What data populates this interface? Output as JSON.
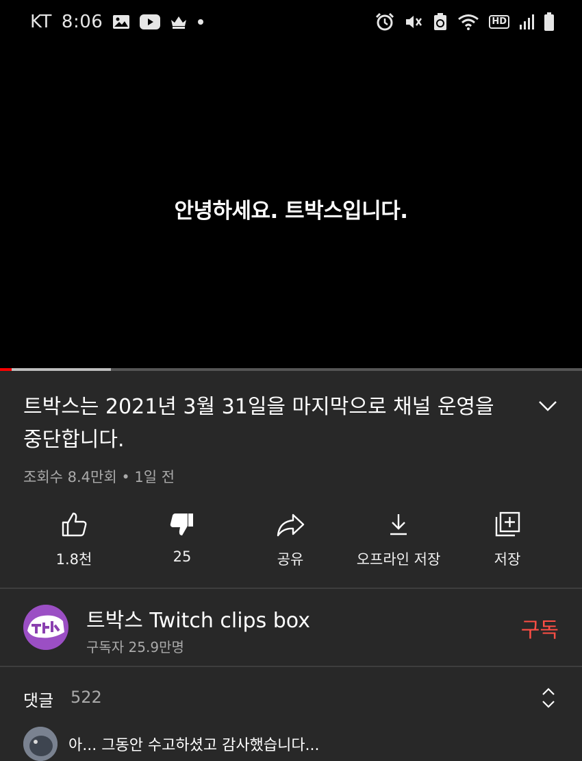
{
  "status_bar": {
    "carrier": "KT",
    "time": "8:06",
    "left_icons": [
      "gallery-icon",
      "youtube-icon",
      "crown-icon",
      "dot-icon"
    ],
    "right_icons": [
      "alarm-icon",
      "mute-icon",
      "recycle-icon",
      "wifi-icon",
      "hd-icon",
      "signal-icon",
      "battery-icon"
    ],
    "hd_label": "HD"
  },
  "video": {
    "caption": "안녕하세요. 트박스입니다.",
    "progress_fraction": 0.02,
    "buffered_fraction": 0.19
  },
  "details": {
    "title": "트박스는 2021년 3월 31일을 마지막으로 채널 운영을 중단합니다.",
    "meta": "조회수 8.4만회 • 1일 전"
  },
  "actions": [
    {
      "label": "1.8천",
      "icon": "like-icon"
    },
    {
      "label": "25",
      "icon": "dislike-icon"
    },
    {
      "label": "공유",
      "icon": "share-icon"
    },
    {
      "label": "오프라인 저장",
      "icon": "download-icon"
    },
    {
      "label": "저장",
      "icon": "add-to-playlist-icon"
    }
  ],
  "channel": {
    "name": "트박스 Twitch clips box",
    "subscribers": "구독자 25.9만명",
    "subscribe_label": "구독",
    "subscribe_color": "#ff4e45"
  },
  "comments": {
    "label": "댓글",
    "count": "522",
    "first_comment": "아... 그동안 수고하셨고 감사했습니다..."
  },
  "colors": {
    "background": "#282828",
    "progress": "#ff0000",
    "secondary_text": "#aaaaaa"
  }
}
